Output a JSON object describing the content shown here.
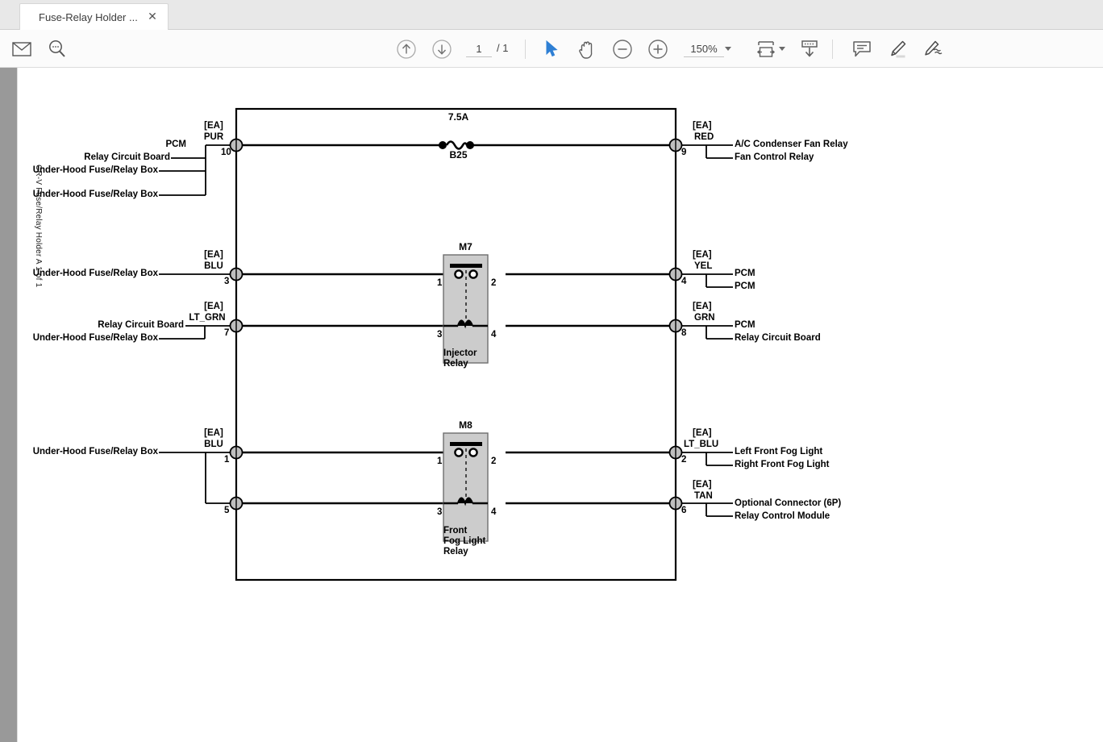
{
  "tab": {
    "title": "Fuse-Relay Holder ...",
    "close_icon": "close-icon"
  },
  "toolbar": {
    "mail_icon": "mail-icon",
    "search_icon": "search-icon",
    "prev_page_icon": "arrow-up-circle-icon",
    "next_page_icon": "arrow-down-circle-icon",
    "page_current": "1",
    "page_total": "/ 1",
    "select_icon": "cursor-arrow-icon",
    "pan_icon": "hand-icon",
    "zoom_out_icon": "minus-circle-icon",
    "zoom_in_icon": "plus-circle-icon",
    "zoom_level": "150%",
    "fit_width_icon": "fit-width-icon",
    "download_icon": "download-icon",
    "comment_icon": "comment-icon",
    "highlight_icon": "highlighter-icon",
    "draw_icon": "pen-draw-icon"
  },
  "document": {
    "side_label": "CR-V Fuse/Relay Holder A 1 of 1"
  },
  "schematic": {
    "fuse": {
      "rating": "7.5A",
      "id": "B25"
    },
    "relays": [
      {
        "id": "M7",
        "name_line1": "Injector",
        "name_line2": "Relay",
        "pins": [
          "1",
          "2",
          "3",
          "4"
        ]
      },
      {
        "id": "M8",
        "name_line1": "Front",
        "name_line2": "Fog Light",
        "name_line3": "Relay",
        "pins": [
          "1",
          "2",
          "3",
          "4"
        ]
      }
    ],
    "left_terminals": [
      {
        "pin": "10",
        "wire_tag": "[EA]",
        "wire_color": "PUR",
        "destinations": [
          "PCM",
          "Relay Circuit Board",
          "Under-Hood Fuse/Relay Box",
          "Under-Hood Fuse/Relay Box"
        ]
      },
      {
        "pin": "3",
        "wire_tag": "[EA]",
        "wire_color": "BLU",
        "destinations": [
          "Under-Hood Fuse/Relay Box"
        ]
      },
      {
        "pin": "7",
        "wire_tag": "[EA]",
        "wire_color": "LT_GRN",
        "destinations": [
          "Relay Circuit Board",
          "Under-Hood Fuse/Relay Box"
        ]
      },
      {
        "pin": "1",
        "wire_tag": "[EA]",
        "wire_color": "BLU",
        "destinations": [
          "Under-Hood Fuse/Relay Box"
        ]
      },
      {
        "pin": "5",
        "wire_tag": "",
        "wire_color": "",
        "destinations": []
      }
    ],
    "right_terminals": [
      {
        "pin": "9",
        "wire_tag": "[EA]",
        "wire_color": "RED",
        "destinations": [
          "A/C Condenser Fan Relay",
          "Fan Control Relay"
        ]
      },
      {
        "pin": "4",
        "wire_tag": "[EA]",
        "wire_color": "YEL",
        "destinations": [
          "PCM",
          "PCM"
        ]
      },
      {
        "pin": "8",
        "wire_tag": "[EA]",
        "wire_color": "GRN",
        "destinations": [
          "PCM",
          "Relay Circuit Board"
        ]
      },
      {
        "pin": "2",
        "wire_tag": "[EA]",
        "wire_color": "LT_BLU",
        "destinations": [
          "Left Front Fog Light",
          "Right Front Fog Light"
        ]
      },
      {
        "pin": "6",
        "wire_tag": "[EA]",
        "wire_color": "TAN",
        "destinations": [
          "Optional Connector (6P)",
          "Relay Control Module"
        ]
      }
    ]
  },
  "colors": {
    "accent": "#2e7fd4",
    "relay_fill": "#cccccc",
    "terminal_fill": "#bfbfbf",
    "sidebar_gray": "#999999",
    "tabstrip_gray": "#e8e8e8"
  }
}
